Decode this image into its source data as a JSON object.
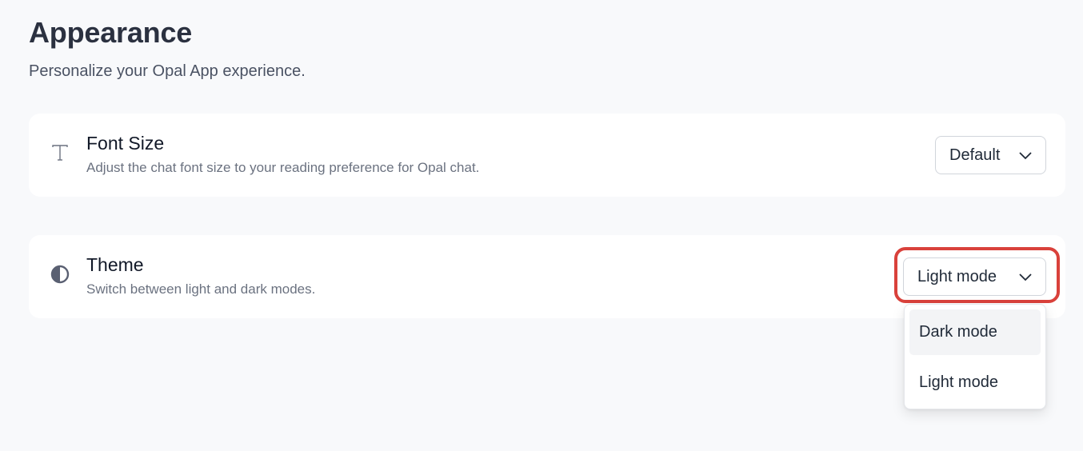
{
  "header": {
    "title": "Appearance",
    "subtitle": "Personalize your Opal App experience."
  },
  "settings": {
    "font_size": {
      "icon": "text-icon",
      "label": "Font Size",
      "description": "Adjust the chat font size to your reading preference for Opal chat.",
      "selected": "Default"
    },
    "theme": {
      "icon": "half-circle-contrast-icon",
      "label": "Theme",
      "description": "Switch between light and dark modes.",
      "selected": "Light mode",
      "options": [
        "Dark mode",
        "Light mode"
      ],
      "dropdown_open": true
    }
  },
  "colors": {
    "background": "#f8f9fb",
    "card": "#ffffff",
    "highlight": "#d9413b"
  }
}
